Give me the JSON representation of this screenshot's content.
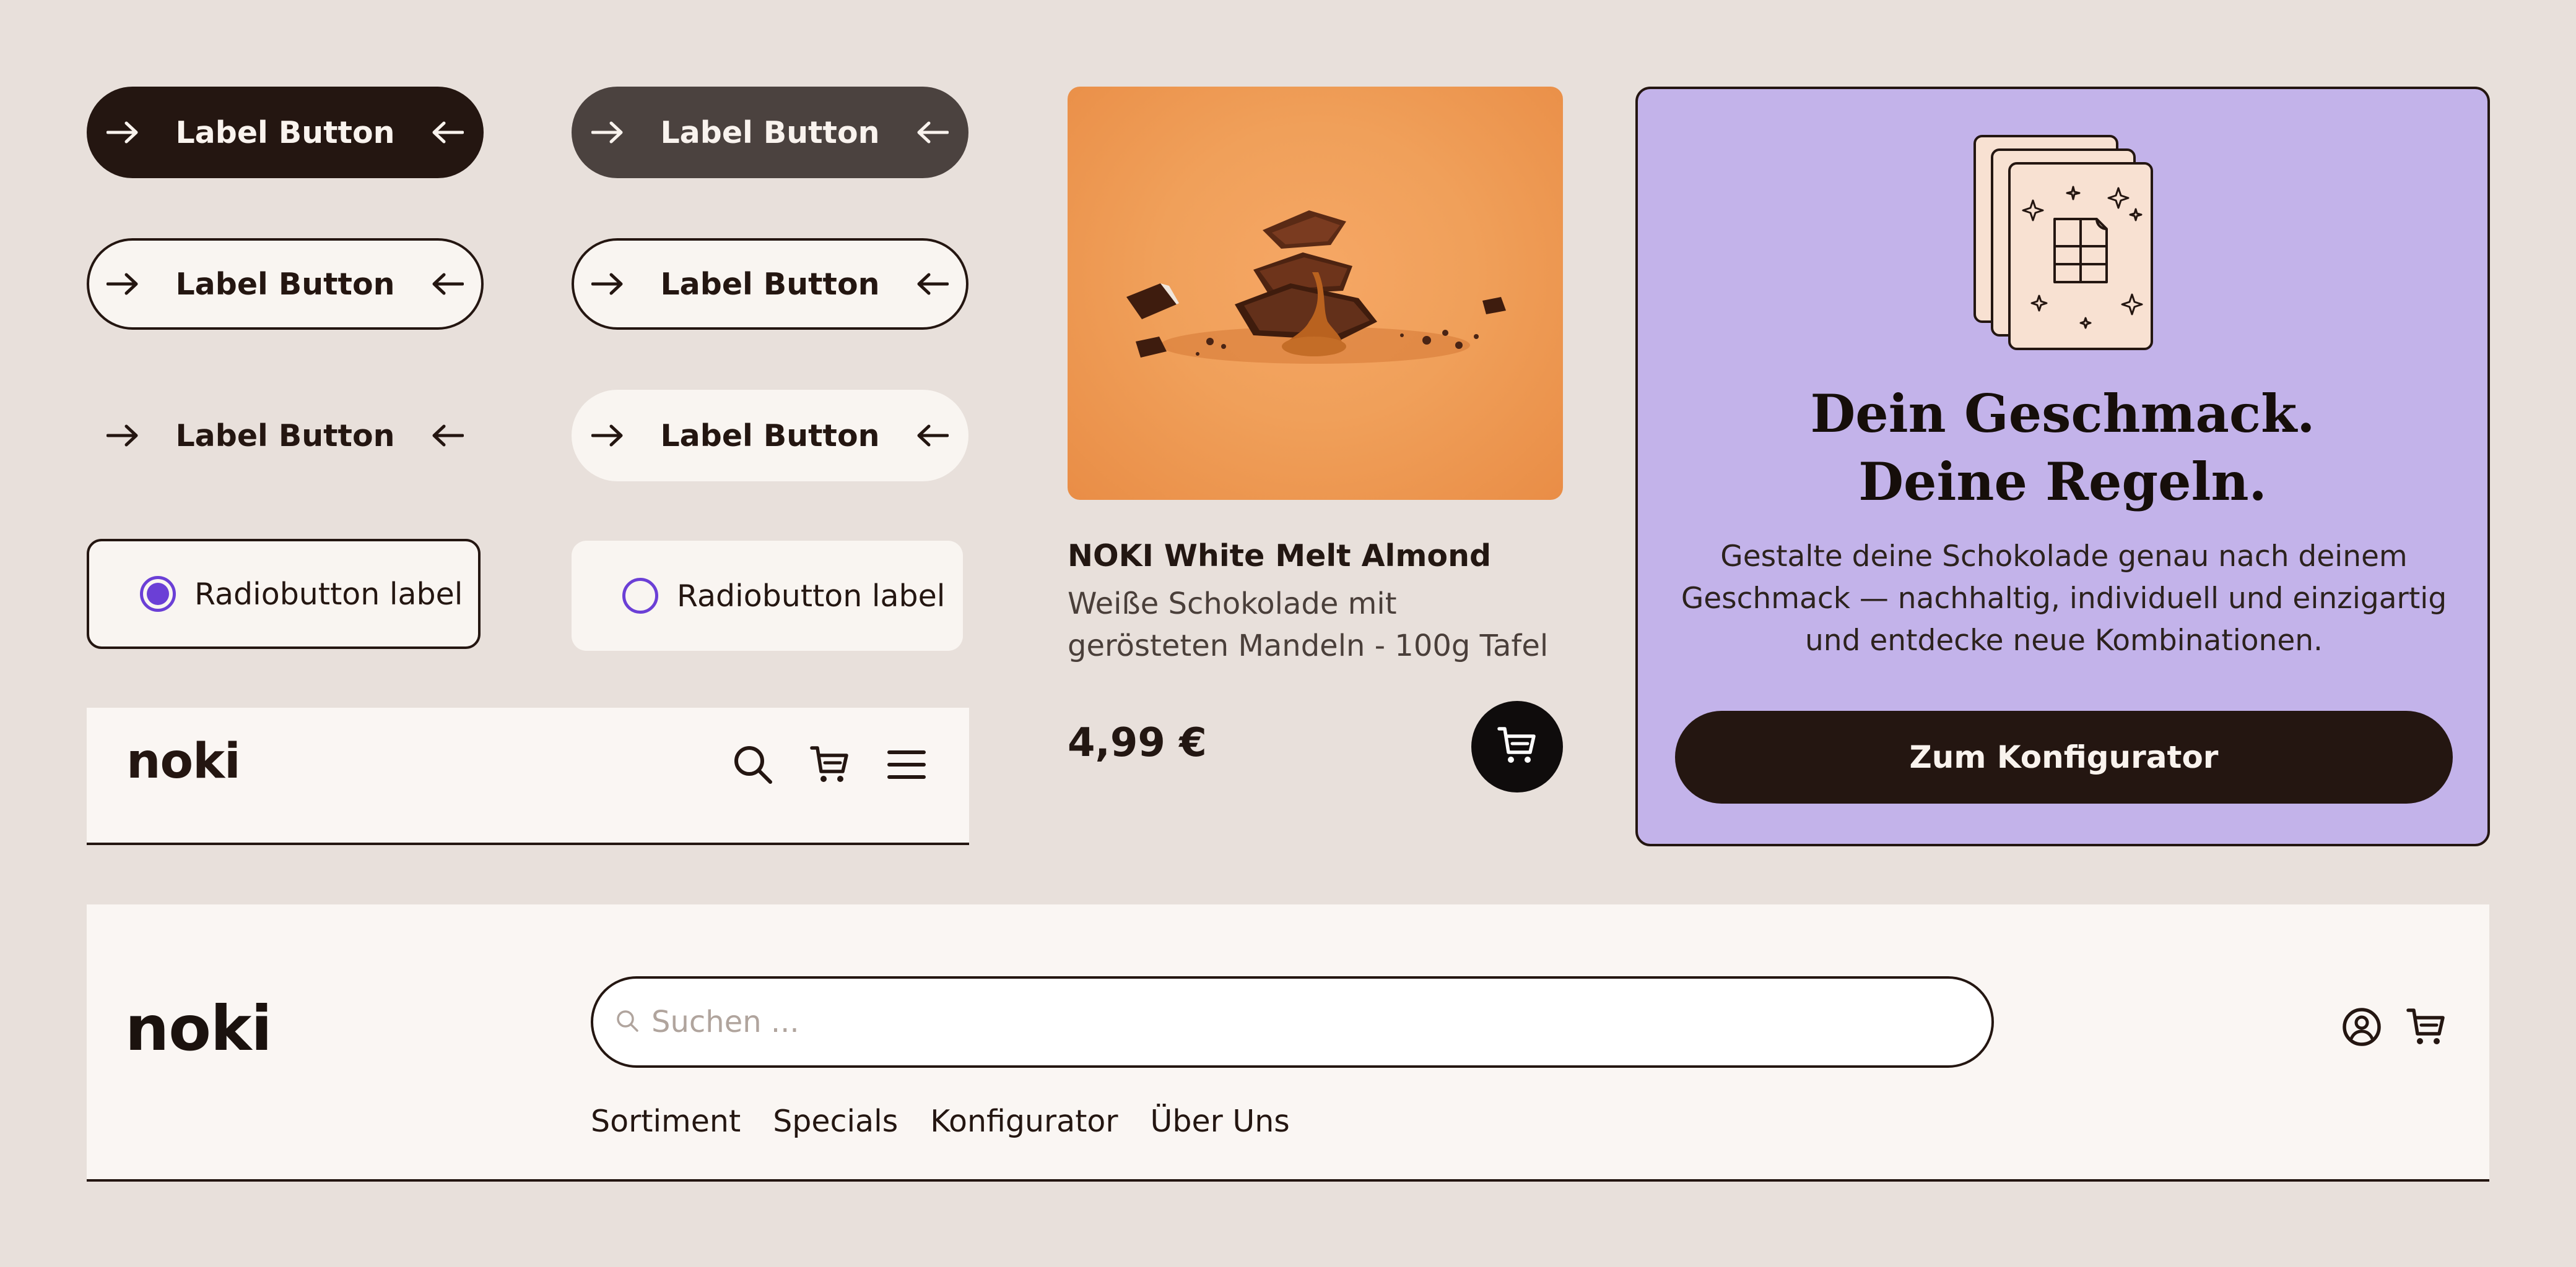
{
  "buttons": {
    "primary": "Label Button",
    "secondary": "Label Button",
    "outline_1": "Label Button",
    "outline_2": "Label Button",
    "ghost": "Label Button",
    "soft": "Label Button"
  },
  "radios": {
    "selected_label": "Radiobutton label",
    "unselected_label": "Radiobutton label"
  },
  "mini_nav": {
    "logo": "noki"
  },
  "product": {
    "name": "NOKI White Melt Almond",
    "description": "Weiße Schokolade mit gerösteten Mandeln - 100g Tafel",
    "price": "4,99 €"
  },
  "promo": {
    "title_line1": "Dein Geschmack.",
    "title_line2": "Deine Regeln.",
    "text": "Gestalte deine Schokolade genau nach deinem Geschmack — nachhaltig, individuell und einzigartig und entdecke neue Kombinationen.",
    "cta": "Zum Konfigurator"
  },
  "header": {
    "logo": "noki",
    "search_placeholder": "Suchen ...",
    "nav": [
      "Sortiment",
      "Specials",
      "Konfigurator",
      "Über Uns"
    ]
  },
  "colors": {
    "background": "#e8e0db",
    "dark": "#241611",
    "secondary": "#4b423f",
    "cream": "#f9f5f1",
    "accent_purple": "#6b3fd6",
    "promo_bg": "#c3b3ea",
    "product_bg": "#f0a05a"
  },
  "icons": [
    "arrow-right-icon",
    "arrow-left-icon",
    "search-icon",
    "cart-icon",
    "menu-icon",
    "user-icon",
    "chocolate-bar-icon",
    "sparkle-icon"
  ]
}
